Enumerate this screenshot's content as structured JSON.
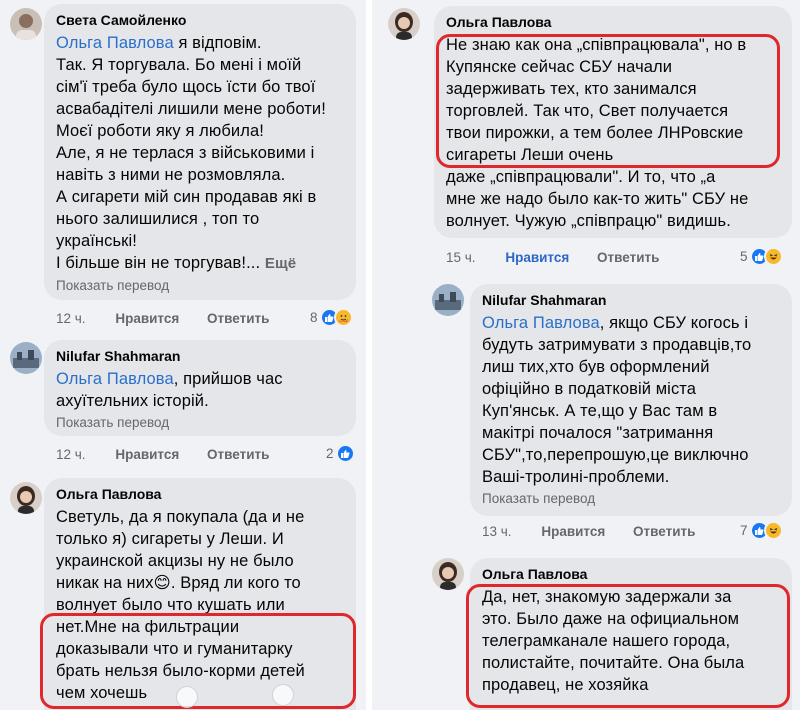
{
  "left": {
    "c1": {
      "author": "Света Самойленко",
      "mention": "Ольга Павлова",
      "lines": [
        "я відповім.",
        "Так. Я торгувала. Бо мені і моїй",
        "сім'ї треба було щось їсти бо твої",
        "асвабадітелі лишили мене роботи!",
        "Моєї роботи яку я любила!",
        "Але, я не терлася з військовими і",
        "навіть з ними не розмовляла.",
        "А сигарети мій син продавав які в",
        "нього залишилися , топ то",
        "українські!"
      ],
      "last_line": "І більше він не торгував!...",
      "more": "Ещё",
      "translate": "Показать перевод",
      "time": "12 ч.",
      "like": "Нравится",
      "reply": "Ответить",
      "reaction_count": "8"
    },
    "c2": {
      "author": "Nilufar Shahmaran",
      "mention": "Ольга Павлова",
      "lines": [
        ", прийшов час",
        "ахуїтельних історій."
      ],
      "translate": "Показать перевод",
      "time": "12 ч.",
      "like": "Нравится",
      "reply": "Ответить",
      "reaction_count": "2"
    },
    "c3": {
      "author": "Ольга Павлова",
      "lines": [
        "Светуль, да я покупала (да и не",
        "только я) сигареты у Леши. И",
        "украинской акцизы ну не было",
        "никак на них😊.  Вряд ли кого то",
        "волнует было что кушать или",
        "нет.Мне на фильтрации",
        "доказывали что и гуманитарку",
        "брать нельзя было-корми детей",
        "чем хочешь"
      ]
    }
  },
  "right": {
    "c1": {
      "author": "Ольга Павлова",
      "lines": [
        "Не знаю как она „співпрацювала\", но в",
        "Купянске сейчас СБУ начали",
        "задерживать тех, кто занимался",
        "торговлей. Так что, Свет получается",
        "твои пирожки, а тем более ЛНРовские",
        "сигареты Леши очень",
        "даже „співпрацювали\". И то, что „а",
        "мне же надо было как-то жить\" СБУ не",
        "волнует. Чужую „співпрацю\" видишь."
      ],
      "time": "15 ч.",
      "like": "Нравится",
      "reply": "Ответить",
      "reaction_count": "5"
    },
    "c2": {
      "author": "Nilufar Shahmaran",
      "mention": "Ольга Павлова",
      "lines": [
        ", якщо СБУ когось і",
        "будуть затримувати з продавців,то",
        "лиш тих,хто був оформлений",
        "офіційно в податковій міста",
        "Куп'янськ. А те,що у Вас там в",
        "макітрі почалося \"затримання",
        "СБУ\",то,перепрошую,це виключно",
        "Ваші-тролині-проблеми."
      ],
      "translate": "Показать перевод",
      "time": "13 ч.",
      "like": "Нравится",
      "reply": "Ответить",
      "reaction_count": "7"
    },
    "c3": {
      "author": "Ольга Павлова",
      "lines": [
        "Да, нет, знакомую задержали за",
        "это. Было даже на официальном",
        "телеграмканале нашего города,",
        "полистайте, почитайте. Она была",
        "продавец, не хозяйка"
      ]
    }
  },
  "colors": {
    "background": "#f0f2f5",
    "bubble": "#e4e6ea",
    "mention": "#2c6fc9",
    "like_active": "#2e66c8",
    "highlight_box": "#e0272b",
    "reaction_like": "#1877f2",
    "reaction_haha": "#f7b928"
  }
}
